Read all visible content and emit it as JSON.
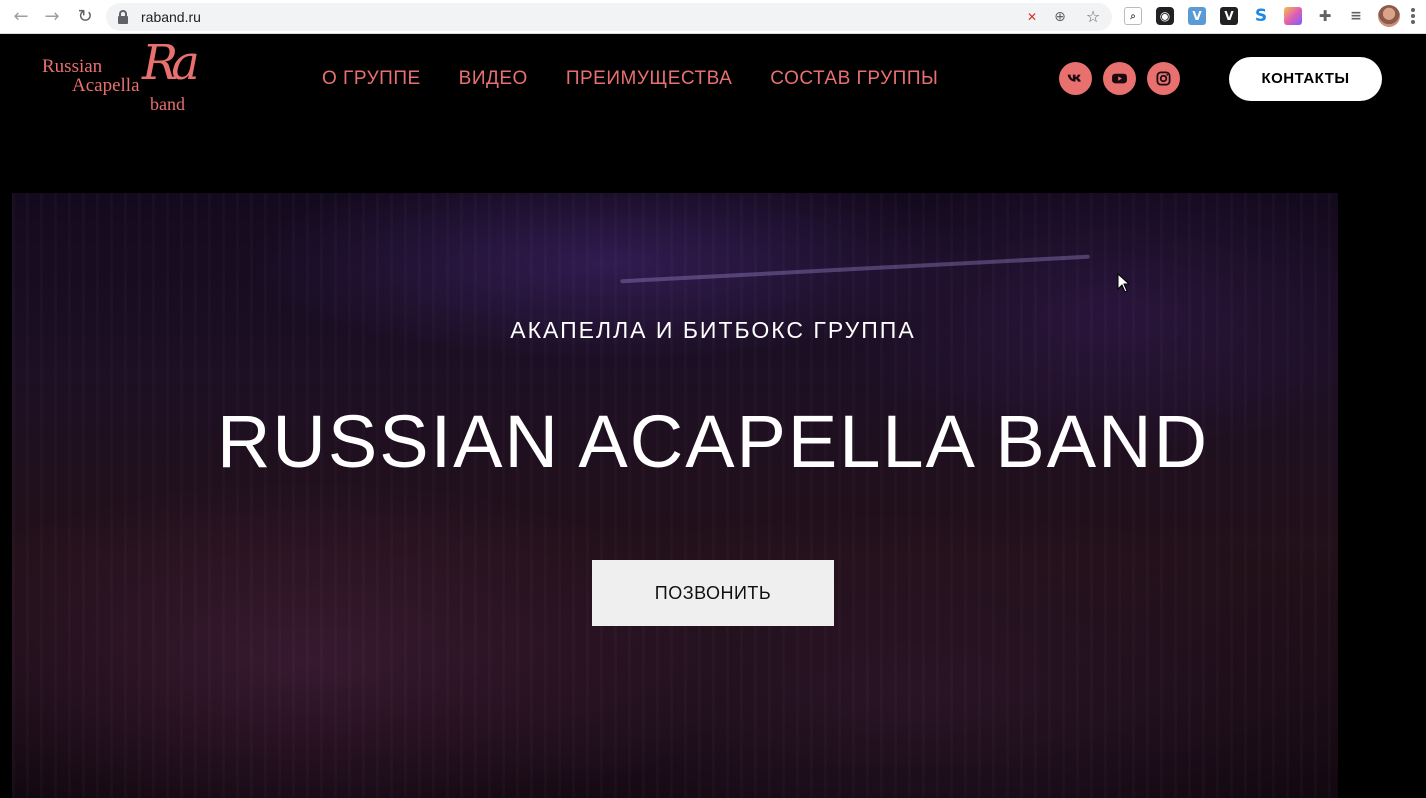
{
  "browser": {
    "url": "raband.ru",
    "icons": [
      "back-arrow-icon",
      "forward-arrow-icon",
      "reload-icon",
      "lock-icon",
      "site-settings-icon",
      "zoom-icon",
      "bookmark-star-icon"
    ],
    "extensions": [
      {
        "name": "search-ext-icon",
        "label": "",
        "color": "#ffffff"
      },
      {
        "name": "camera-ext-icon",
        "label": "",
        "color": "#202124"
      },
      {
        "name": "v-ext-icon",
        "label": "V",
        "color": "#5b9bd5"
      },
      {
        "name": "v-dark-ext-icon",
        "label": "V",
        "color": "#202124"
      },
      {
        "name": "s-ext-icon",
        "label": "S",
        "color": "#1e88e5"
      },
      {
        "name": "gradient-ext-icon",
        "label": "",
        "color": "#e060b0"
      },
      {
        "name": "puzzle-icon",
        "label": "",
        "color": "#5f6368"
      },
      {
        "name": "media-icon",
        "label": "",
        "color": "#5f6368"
      }
    ]
  },
  "site": {
    "logo": {
      "line1": "Russian",
      "line2": "Acapella",
      "line3": "band",
      "monogram": "Ra"
    },
    "nav": [
      {
        "label": "О ГРУППЕ"
      },
      {
        "label": "ВИДЕО"
      },
      {
        "label": "ПРЕИМУЩЕСТВА"
      },
      {
        "label": "СОСТАВ ГРУППЫ"
      }
    ],
    "social": [
      "vk-icon",
      "youtube-icon",
      "instagram-icon"
    ],
    "contacts_label": "КОНТАКТЫ",
    "hero": {
      "subtitle": "АКАПЕЛЛА И БИТБОКС ГРУППА",
      "title": "RUSSIAN ACAPELLA BAND",
      "cta_label": "ПОЗВОНИТЬ"
    },
    "colors": {
      "accent": "#e8706f",
      "background": "#000000",
      "button": "#efefef"
    }
  }
}
